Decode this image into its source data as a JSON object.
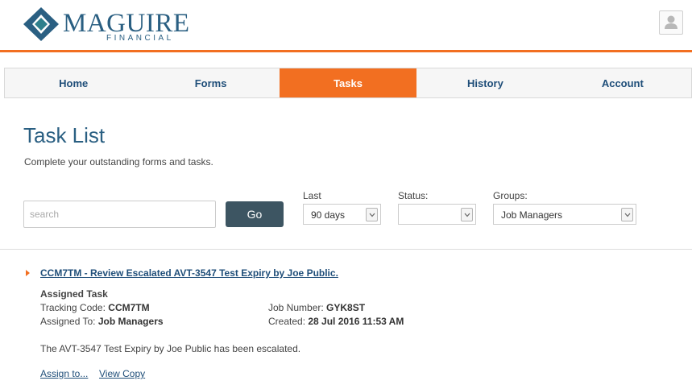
{
  "header": {
    "logo_main": "MAGUIRE",
    "logo_sub": "FINANCIAL",
    "colors": {
      "brand_blue": "#2a5f82",
      "accent_orange": "#f26f21",
      "logo_teal": "#2e7f8c"
    }
  },
  "nav": {
    "items": [
      {
        "label": "Home"
      },
      {
        "label": "Forms"
      },
      {
        "label": "Tasks",
        "active": true
      },
      {
        "label": "History"
      },
      {
        "label": "Account"
      }
    ]
  },
  "main": {
    "title": "Task List",
    "subtitle": "Complete your outstanding forms and tasks."
  },
  "filters": {
    "search_placeholder": "search",
    "search_value": "",
    "go_label": "Go",
    "last_label": "Last",
    "last_value": "90 days",
    "status_label": "Status:",
    "status_value": "",
    "groups_label": "Groups:",
    "groups_value": "Job Managers"
  },
  "task": {
    "title": "CCM7TM - Review Escalated AVT-3547 Test Expiry by Joe Public.",
    "type": "Assigned Task",
    "tracking_code_label": "Tracking Code:",
    "tracking_code": "CCM7TM",
    "assigned_to_label": "Assigned To:",
    "assigned_to": "Job Managers",
    "job_number_label": "Job Number:",
    "job_number": "GYK8ST",
    "created_label": "Created:",
    "created": "28 Jul 2016 11:53 AM",
    "description": "The AVT-3547 Test Expiry by Joe Public has been escalated.",
    "actions": {
      "assign": "Assign to...",
      "view_copy": "View Copy"
    }
  }
}
